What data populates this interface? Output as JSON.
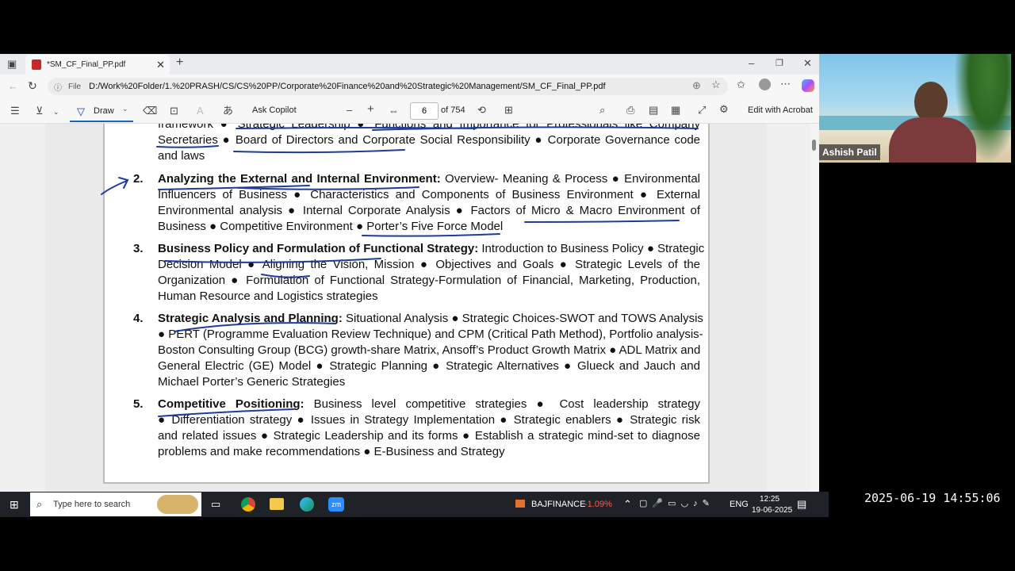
{
  "browser": {
    "tab_title": "*SM_CF_Final_PP.pdf",
    "tab_close": "✕",
    "new_tab": "+",
    "window_controls": [
      "–",
      "❐",
      "✕"
    ],
    "address_label": "File",
    "url": "D:/Work%20Folder/1.%20PRASH/CS/CS%20PP/Corporate%20Finance%20and%20Strategic%20Management/SM_CF_Final_PP.pdf"
  },
  "pdf_toolbar": {
    "draw_label": "Draw",
    "ask_copilot": "Ask Copilot",
    "page_number": "6",
    "page_total": "of 754",
    "edit_acrobat": "Edit with Acrobat",
    "zoom_out": "–",
    "zoom_in": "+"
  },
  "document": {
    "lines_top": [
      "framework ● Strategic Leadership ● Functions and Importance for Professionals like Company",
      "Secretaries ● Board of Directors and Corporate Social Responsibility ● Corporate Governance code",
      "and laws"
    ],
    "items": [
      {
        "number": "2.",
        "heading": "Analyzing the External and Internal Environment:",
        "lines": [
          " Overview- Meaning & Process ● Environmental",
          "Influencers of Business ● Characteristics and Components of Business Environment ● External",
          "Environmental analysis ● Internal Corporate Analysis ● Factors of Micro & Macro Environment of",
          "Business ● Competitive Environment ● Porter’s Five Force Model"
        ]
      },
      {
        "number": "3.",
        "heading": "Business Policy and Formulation of Functional Strategy:",
        "lines": [
          " Introduction to Business Policy ● Strategic",
          "Decision Model ● Aligning the Vision, Mission ● Objectives and Goals ● Strategic Levels of the",
          "Organization ● Formulation of Functional Strategy-Formulation of Financial, Marketing, Production,",
          "Human Resource and Logistics strategies"
        ]
      },
      {
        "number": "4.",
        "heading": "Strategic Analysis and Planning:",
        "lines": [
          " Situational Analysis ● Strategic Choices-SWOT and TOWS Analysis",
          "● PERT (Programme Evaluation Review Technique) and CPM (Critical Path Method), Portfolio analysis-",
          "Boston Consulting Group (BCG) growth-share Matrix, Ansoff’s Product Growth Matrix ● ADL Matrix and",
          "General Electric (GE) Model ● Strategic Planning ●  Strategic Alternatives ● Glueck and Jauch and",
          "Michael Porter’s Generic Strategies"
        ]
      },
      {
        "number": "5.",
        "heading": "Competitive Positioning:",
        "lines": [
          " Business level competitive strategies ● Cost leadership strategy",
          "● Differentiation strategy ● Issues in Strategy Implementation ● Strategic enablers ● Strategic risk",
          "and related issues ● Strategic Leadership and its forms ● Establish a strategic mind-set to diagnose",
          "problems and make recommendations ●  E-Business and Strategy"
        ]
      }
    ]
  },
  "webcam": {
    "name": "Ashish Patil"
  },
  "taskbar": {
    "search_placeholder": "Type here to search",
    "stock_name": "BAJFINANCE",
    "stock_change": "-1.09%",
    "language": "ENG",
    "time": "12:25",
    "date": "19-06-2025"
  },
  "overlay_timestamp": "2025-06-19 14:55:06",
  "colors": {
    "ink": "#1f3b9c",
    "stock_down": "#ff5a4f",
    "taskbar": "#1f2328"
  }
}
